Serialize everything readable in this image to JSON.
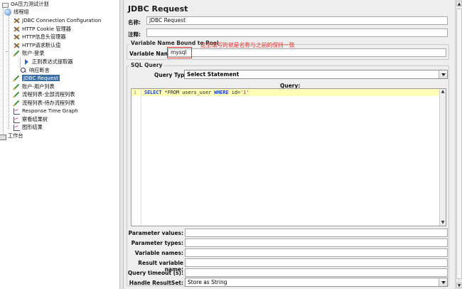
{
  "tree": {
    "root": "OA压力测试计划",
    "thread_group": "线程组",
    "items": [
      {
        "label": "JDBC Connection Configuration",
        "icon": "wrench-icon"
      },
      {
        "label": "HTTP Cookie 管理器",
        "icon": "wrench-icon"
      },
      {
        "label": "HTTP信息头管理器",
        "icon": "wrench-icon"
      },
      {
        "label": "HTTP请求默认值",
        "icon": "wrench-icon"
      },
      {
        "label": "账户-登录",
        "icon": "sampler-icon"
      },
      {
        "label": "正则表达式提取器",
        "icon": "extractor-icon"
      },
      {
        "label": "响应断言",
        "icon": "assertion-icon"
      },
      {
        "label": "JDBC Request",
        "icon": "sampler-icon"
      },
      {
        "label": "账户-用户列表",
        "icon": "sampler-icon"
      },
      {
        "label": "流程列表-全部流程列表",
        "icon": "sampler-icon"
      },
      {
        "label": "流程列表-待办流程列表",
        "icon": "sampler-icon"
      },
      {
        "label": "Response Time Graph",
        "icon": "graph-icon"
      },
      {
        "label": "察看结果树",
        "icon": "graph-icon"
      },
      {
        "label": "图形结果",
        "icon": "graph-icon"
      }
    ],
    "workbench": "工作台"
  },
  "panel": {
    "title": "JDBC Request",
    "name_label": "名称:",
    "name_value": "JDBC Request",
    "comment_label": "注释:",
    "comment_value": "",
    "pool_group_title": "Variable Name Bound to Pool",
    "var_name_label": "Variable Name:",
    "var_name_value": "mysql",
    "annotation": "这里填写的就是名称与之前的保持一致",
    "sql_group_title": "SQL Query",
    "query_type_label": "Query Type:",
    "query_type_value": "Select Statement",
    "query_header": "Query:",
    "line_number": "1",
    "sql_kw1": "SELECT",
    "sql_mid": " *FROM users_user ",
    "sql_kw2": "WHERE",
    "sql_tail": " id=",
    "sql_str": "'1'",
    "params": {
      "param_values_label": "Parameter values:",
      "param_types_label": "Parameter types:",
      "var_names_label": "Variable names:",
      "result_var_label": "Result variable name:",
      "timeout_label": "Query timeout (s):",
      "handle_label": "Handle ResultSet:",
      "handle_value": "Store as String"
    }
  },
  "colors": {
    "selection": "#3a6ea5",
    "annotation": "#e0342c",
    "editor_highlight": "#ffffb8"
  }
}
